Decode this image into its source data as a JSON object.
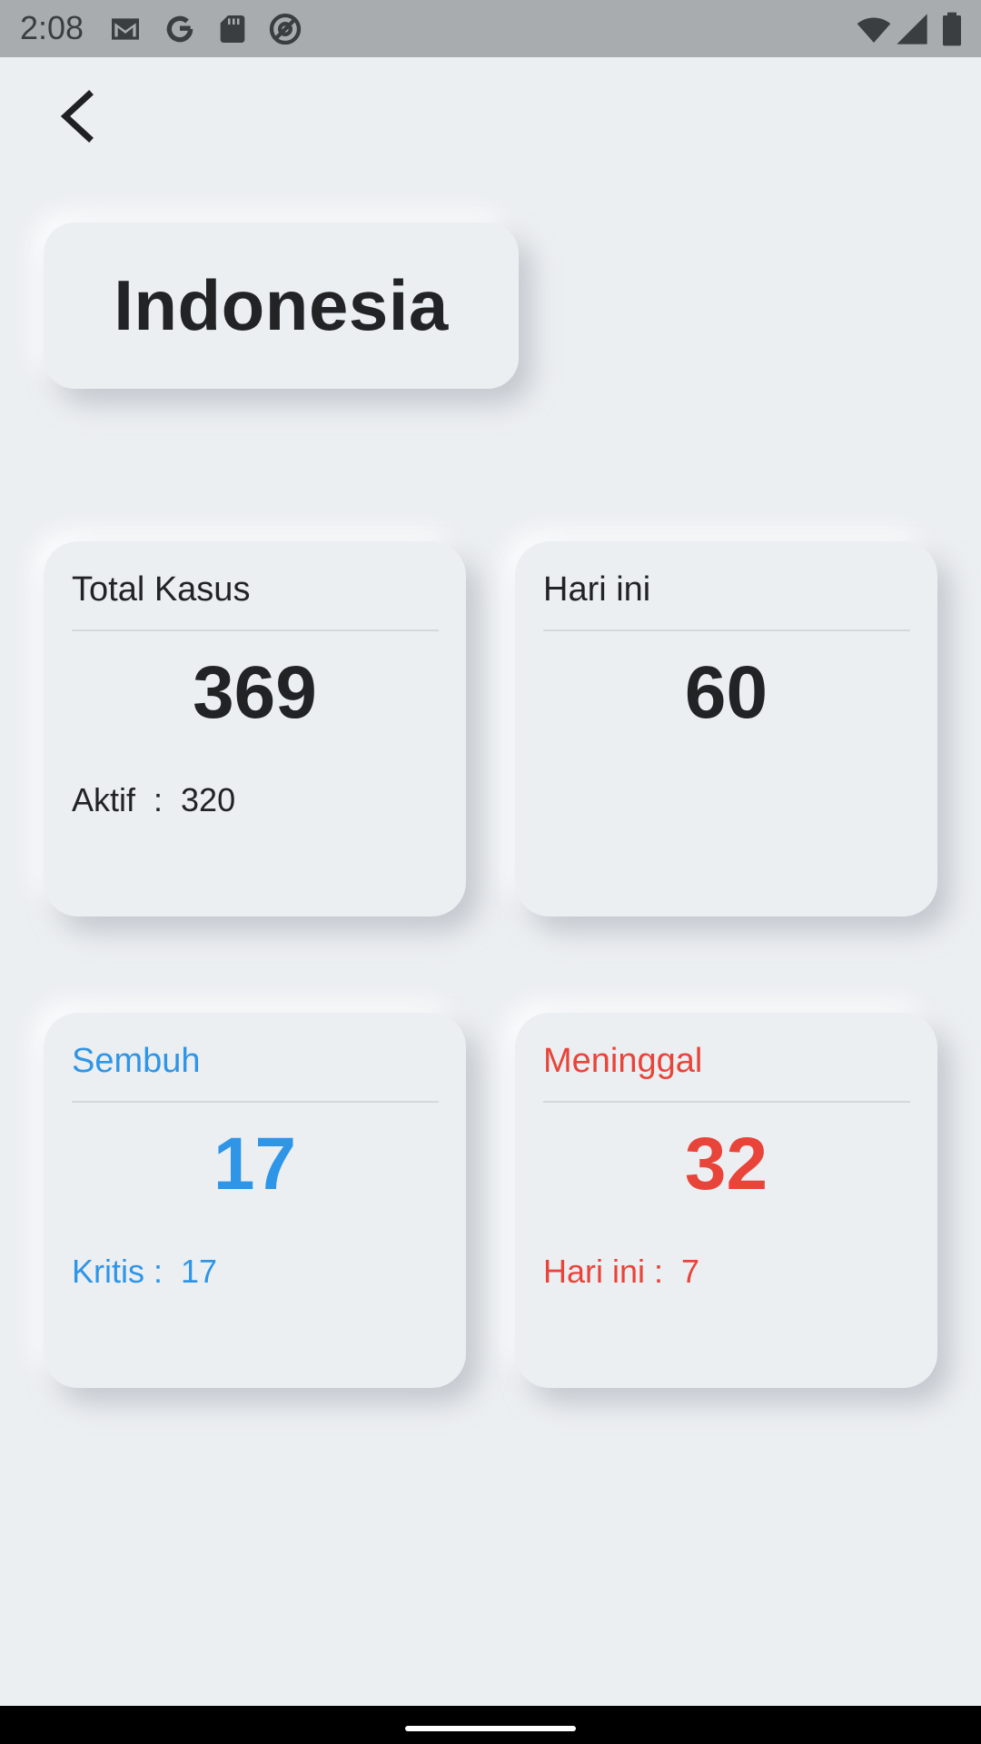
{
  "status_bar": {
    "time": "2:08",
    "left_icons": [
      "gmail-icon",
      "google-icon",
      "sd-card-icon",
      "at-sign-icon"
    ],
    "right_icons": [
      "wifi-icon",
      "cell-signal-icon",
      "battery-icon"
    ]
  },
  "header": {
    "back_icon": "chevron-left-icon"
  },
  "country": {
    "name": "Indonesia"
  },
  "cards": {
    "total": {
      "title": "Total Kasus",
      "value": "369",
      "sub": "Aktif  :  320"
    },
    "today": {
      "title": "Hari ini",
      "value": "60"
    },
    "recovered": {
      "title": "Sembuh",
      "value": "17",
      "sub": "Kritis :  17",
      "color": "#2f95e6"
    },
    "deaths": {
      "title": "Meninggal",
      "value": "32",
      "sub": "Hari ini :  7",
      "color": "#e8443a"
    }
  },
  "colors": {
    "background": "#eceff2",
    "text": "#222324",
    "status_bar": "#a9acaf"
  }
}
